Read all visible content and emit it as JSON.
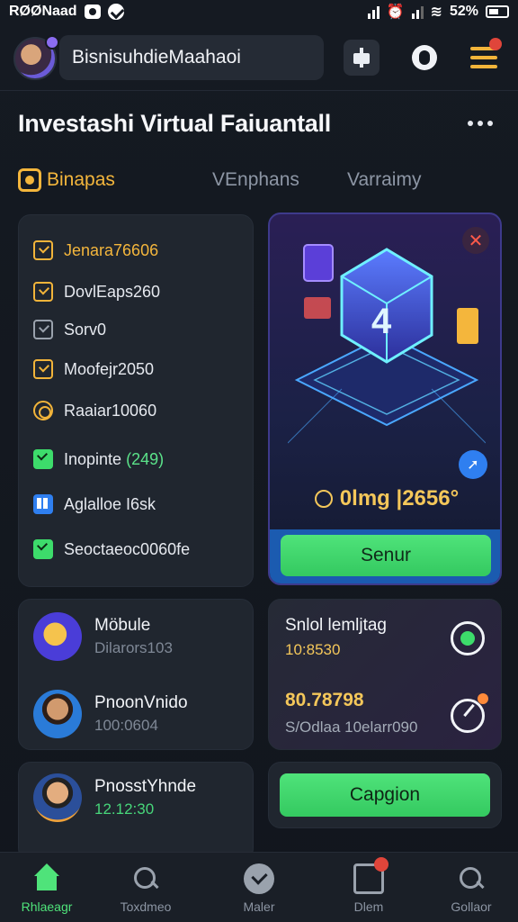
{
  "status_bar": {
    "carrier": "RØØNaad",
    "battery": "52%"
  },
  "header": {
    "account_name": "BisnisuhdieMaahaoi"
  },
  "page": {
    "title": "Investashi Virtual Faiuantall"
  },
  "tabs": [
    {
      "label": "Binapas"
    },
    {
      "label": "VEnphans"
    },
    {
      "label": "Varraimy"
    }
  ],
  "checklist": [
    {
      "label": "Jenara76606"
    },
    {
      "label": "DovlEaps260"
    },
    {
      "label": "Sorv0"
    },
    {
      "label": "Moofejr2050"
    },
    {
      "label": "Raaiar10060"
    },
    {
      "label": "Inopinte",
      "value": "(249)"
    },
    {
      "label": "Aglalloe I6sk"
    },
    {
      "label": "Seoctaeoc0060fe"
    }
  ],
  "feature_card": {
    "value": "0lmg |2656°",
    "button_label": "Senur",
    "art_label": "4"
  },
  "contacts": [
    {
      "name": "Möbule",
      "sub": "Dilarors103"
    },
    {
      "name": "PnoonVnido",
      "sub": "100:0604"
    },
    {
      "name": "PnosstYhnde",
      "sub": "12.12:30"
    }
  ],
  "stats_card": {
    "title": "Snlol lemljtag",
    "sub": "10:8530",
    "big_value": "80.78798",
    "note": "S/Odlaa 10elarr090"
  },
  "action_card": {
    "button_label": "Capgion"
  },
  "bottom_nav": [
    {
      "label": "Rhlaeagr"
    },
    {
      "label": "Toxdmeo"
    },
    {
      "label": "Maler"
    },
    {
      "label": "Dlem"
    },
    {
      "label": "Gollaor"
    }
  ],
  "colors": {
    "accent_yellow": "#f4b63c",
    "accent_green": "#4fe37a",
    "background": "#141921",
    "card": "#20262f"
  }
}
